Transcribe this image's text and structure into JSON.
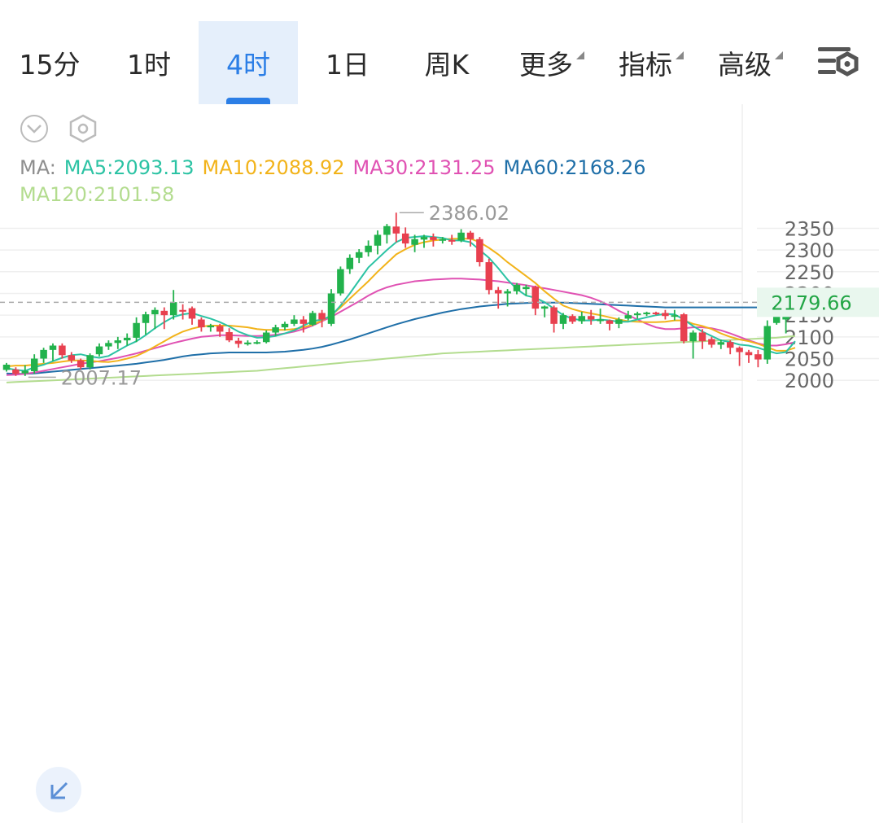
{
  "tabs": [
    {
      "label": "15分",
      "active": false
    },
    {
      "label": "1时",
      "active": false
    },
    {
      "label": "4时",
      "active": true
    },
    {
      "label": "1日",
      "active": false
    },
    {
      "label": "周K",
      "active": false
    },
    {
      "label": "更多",
      "active": false,
      "dropdown": true
    },
    {
      "label": "指标",
      "active": false,
      "dropdown": true
    },
    {
      "label": "高级",
      "active": false,
      "dropdown": true
    }
  ],
  "icons": {
    "settings": "settings-sliders-icon",
    "collapse": "chevron-circle-down-icon",
    "indicator": "hexagon-icon",
    "expand": "expand-arrows-icon"
  },
  "ma_legend": {
    "prefix": "MA:",
    "ma5": "MA5:2093.13",
    "ma10": "MA10:2088.92",
    "ma30": "MA30:2131.25",
    "ma60": "MA60:2168.26",
    "ma120": "MA120:2101.58"
  },
  "colors": {
    "up": "#22b24c",
    "down": "#e8404f",
    "ma5": "#2cc3a4",
    "ma10": "#f2b31a",
    "ma30": "#e052b3",
    "ma60": "#1f6fa8",
    "ma120": "#b3dc8f",
    "active_tab": "#2b7ee6"
  },
  "chart_data": {
    "type": "candlestick",
    "y_ticks": [
      "2350",
      "2300",
      "2250",
      "2200",
      "2150",
      "2100",
      "2050",
      "2000"
    ],
    "ylim": [
      1985,
      2400
    ],
    "grid": true,
    "high_label": "2386.02",
    "low_label": "2007.17",
    "current_price": "2179.66",
    "current_value": 2179.66,
    "candles": [
      [
        2024,
        2036,
        2020,
        2040
      ],
      [
        2025,
        2015,
        2010,
        2030
      ],
      [
        2016,
        2022,
        2010,
        2035
      ],
      [
        2021,
        2050,
        2015,
        2060
      ],
      [
        2050,
        2070,
        2040,
        2075
      ],
      [
        2070,
        2080,
        2045,
        2085
      ],
      [
        2080,
        2058,
        2050,
        2085
      ],
      [
        2058,
        2046,
        2040,
        2065
      ],
      [
        2046,
        2030,
        2025,
        2050
      ],
      [
        2030,
        2058,
        2025,
        2062
      ],
      [
        2060,
        2078,
        2055,
        2085
      ],
      [
        2078,
        2086,
        2070,
        2092
      ],
      [
        2086,
        2092,
        2072,
        2100
      ],
      [
        2092,
        2098,
        2080,
        2108
      ],
      [
        2098,
        2132,
        2088,
        2145
      ],
      [
        2132,
        2152,
        2105,
        2158
      ],
      [
        2152,
        2162,
        2118,
        2168
      ],
      [
        2160,
        2150,
        2118,
        2168
      ],
      [
        2150,
        2180,
        2140,
        2208
      ],
      [
        2162,
        2158,
        2140,
        2175
      ],
      [
        2166,
        2142,
        2128,
        2170
      ],
      [
        2140,
        2122,
        2112,
        2145
      ],
      [
        2122,
        2126,
        2112,
        2130
      ],
      [
        2125,
        2112,
        2100,
        2130
      ],
      [
        2111,
        2092,
        2088,
        2120
      ],
      [
        2091,
        2084,
        2075,
        2098
      ],
      [
        2083,
        2087,
        2080,
        2092
      ],
      [
        2085,
        2088,
        2083,
        2092
      ],
      [
        2088,
        2110,
        2085,
        2115
      ],
      [
        2110,
        2122,
        2102,
        2128
      ],
      [
        2122,
        2130,
        2115,
        2135
      ],
      [
        2130,
        2140,
        2125,
        2150
      ],
      [
        2140,
        2130,
        2110,
        2148
      ],
      [
        2128,
        2155,
        2125,
        2160
      ],
      [
        2155,
        2140,
        2122,
        2162
      ],
      [
        2130,
        2200,
        2125,
        2210
      ],
      [
        2200,
        2256,
        2195,
        2262
      ],
      [
        2256,
        2282,
        2245,
        2290
      ],
      [
        2282,
        2295,
        2270,
        2302
      ],
      [
        2295,
        2310,
        2285,
        2322
      ],
      [
        2310,
        2335,
        2290,
        2345
      ],
      [
        2335,
        2355,
        2315,
        2360
      ],
      [
        2354,
        2338,
        2318,
        2386
      ],
      [
        2338,
        2315,
        2305,
        2352
      ],
      [
        2312,
        2325,
        2295,
        2335
      ],
      [
        2324,
        2330,
        2305,
        2335
      ],
      [
        2330,
        2323,
        2308,
        2338
      ],
      [
        2322,
        2325,
        2315,
        2330
      ],
      [
        2323,
        2322,
        2312,
        2335
      ],
      [
        2322,
        2340,
        2318,
        2348
      ],
      [
        2340,
        2325,
        2308,
        2344
      ],
      [
        2325,
        2272,
        2262,
        2330
      ],
      [
        2272,
        2208,
        2198,
        2280
      ],
      [
        2208,
        2200,
        2165,
        2215
      ],
      [
        2200,
        2205,
        2170,
        2210
      ],
      [
        2205,
        2220,
        2198,
        2224
      ],
      [
        2210,
        2215,
        2195,
        2220
      ],
      [
        2215,
        2165,
        2150,
        2218
      ],
      [
        2165,
        2170,
        2145,
        2172
      ],
      [
        2168,
        2130,
        2110,
        2172
      ],
      [
        2130,
        2150,
        2118,
        2155
      ],
      [
        2148,
        2135,
        2130,
        2152
      ],
      [
        2136,
        2148,
        2130,
        2158
      ],
      [
        2148,
        2140,
        2128,
        2162
      ],
      [
        2140,
        2140,
        2130,
        2165
      ],
      [
        2138,
        2130,
        2115,
        2140
      ],
      [
        2130,
        2140,
        2120,
        2145
      ],
      [
        2142,
        2150,
        2138,
        2160
      ],
      [
        2150,
        2154,
        2142,
        2158
      ],
      [
        2154,
        2156,
        2148,
        2158
      ],
      [
        2156,
        2155,
        2150,
        2158
      ],
      [
        2155,
        2148,
        2140,
        2162
      ],
      [
        2148,
        2150,
        2138,
        2162
      ],
      [
        2152,
        2090,
        2085,
        2155
      ],
      [
        2090,
        2110,
        2050,
        2115
      ],
      [
        2110,
        2090,
        2072,
        2118
      ],
      [
        2095,
        2082,
        2075,
        2100
      ],
      [
        2082,
        2088,
        2072,
        2094
      ],
      [
        2088,
        2075,
        2060,
        2092
      ],
      [
        2075,
        2065,
        2033,
        2078
      ],
      [
        2065,
        2058,
        2040,
        2070
      ],
      [
        2060,
        2048,
        2030,
        2070
      ],
      [
        2048,
        2125,
        2038,
        2138
      ],
      [
        2132,
        2148,
        2128,
        2190
      ],
      [
        2140,
        2180,
        2108,
        2188
      ]
    ],
    "ma5": [
      2028,
      2024,
      2022,
      2030,
      2036,
      2044,
      2052,
      2058,
      2060,
      2055,
      2052,
      2056,
      2068,
      2080,
      2090,
      2104,
      2120,
      2134,
      2146,
      2152,
      2155,
      2148,
      2142,
      2134,
      2124,
      2112,
      2104,
      2098,
      2099,
      2102,
      2108,
      2115,
      2126,
      2136,
      2140,
      2148,
      2172,
      2200,
      2230,
      2260,
      2280,
      2300,
      2318,
      2328,
      2330,
      2332,
      2330,
      2328,
      2322,
      2322,
      2318,
      2300,
      2282,
      2258,
      2232,
      2210,
      2195,
      2190,
      2180,
      2165,
      2150,
      2142,
      2138,
      2138,
      2140,
      2138,
      2135,
      2135,
      2140,
      2145,
      2150,
      2153,
      2152,
      2140,
      2125,
      2112,
      2102,
      2092,
      2088,
      2082,
      2080,
      2075,
      2068,
      2062,
      2065,
      2090
    ],
    "ma10": [
      2032,
      2034,
      2034,
      2036,
      2038,
      2040,
      2043,
      2046,
      2046,
      2045,
      2043,
      2042,
      2045,
      2050,
      2056,
      2066,
      2078,
      2090,
      2102,
      2112,
      2119,
      2124,
      2126,
      2126,
      2126,
      2124,
      2122,
      2118,
      2116,
      2116,
      2116,
      2118,
      2122,
      2128,
      2138,
      2150,
      2168,
      2188,
      2208,
      2228,
      2250,
      2270,
      2290,
      2302,
      2312,
      2318,
      2322,
      2324,
      2326,
      2326,
      2326,
      2318,
      2305,
      2290,
      2272,
      2256,
      2240,
      2224,
      2205,
      2188,
      2172,
      2164,
      2158,
      2154,
      2150,
      2145,
      2140,
      2136,
      2135,
      2134,
      2134,
      2135,
      2138,
      2138,
      2130,
      2125,
      2118,
      2108,
      2100,
      2094,
      2090,
      2084,
      2076,
      2068,
      2068,
      2075
    ],
    "ma30": [
      2012,
      2013,
      2015,
      2018,
      2022,
      2026,
      2030,
      2034,
      2038,
      2041,
      2044,
      2048,
      2052,
      2057,
      2062,
      2068,
      2074,
      2080,
      2086,
      2091,
      2096,
      2100,
      2102,
      2104,
      2104,
      2103,
      2102,
      2102,
      2103,
      2105,
      2108,
      2112,
      2118,
      2126,
      2136,
      2146,
      2158,
      2170,
      2182,
      2195,
      2206,
      2214,
      2220,
      2224,
      2228,
      2230,
      2232,
      2233,
      2234,
      2234,
      2233,
      2232,
      2230,
      2228,
      2225,
      2222,
      2219,
      2215,
      2212,
      2208,
      2204,
      2200,
      2196,
      2190,
      2182,
      2172,
      2160,
      2150,
      2140,
      2130,
      2122,
      2118,
      2118,
      2120,
      2122,
      2122,
      2120,
      2115,
      2108,
      2100,
      2092,
      2085,
      2080,
      2080,
      2083,
      2088
    ],
    "ma60": [
      2016,
      2015,
      2015,
      2016,
      2018,
      2020,
      2022,
      2024,
      2026,
      2028,
      2030,
      2032,
      2034,
      2036,
      2038,
      2041,
      2044,
      2047,
      2051,
      2055,
      2058,
      2060,
      2062,
      2063,
      2064,
      2064,
      2064,
      2064,
      2064,
      2065,
      2066,
      2068,
      2070,
      2073,
      2077,
      2082,
      2088,
      2094,
      2101,
      2108,
      2115,
      2122,
      2129,
      2135,
      2141,
      2146,
      2151,
      2156,
      2160,
      2164,
      2167,
      2170,
      2172,
      2174,
      2176,
      2177,
      2178,
      2179,
      2179,
      2179,
      2179,
      2178,
      2177,
      2176,
      2175,
      2174,
      2173,
      2172,
      2171,
      2170,
      2169,
      2168,
      2168,
      2168,
      2168,
      2168,
      2168,
      2168,
      2168,
      2168,
      2168,
      2168,
      2168,
      2168,
      2168,
      2169
    ],
    "ma120": [
      1995,
      1996,
      1997,
      1998,
      1999,
      2000,
      2001,
      2002,
      2003,
      2004,
      2005,
      2006,
      2007,
      2008,
      2009,
      2010,
      2011,
      2012,
      2013,
      2014,
      2015,
      2016,
      2017,
      2018,
      2019,
      2020,
      2021,
      2022,
      2024,
      2026,
      2028,
      2030,
      2032,
      2034,
      2036,
      2038,
      2040,
      2042,
      2044,
      2046,
      2048,
      2050,
      2052,
      2054,
      2056,
      2058,
      2060,
      2062,
      2063,
      2064,
      2065,
      2066,
      2067,
      2068,
      2069,
      2070,
      2071,
      2072,
      2073,
      2074,
      2075,
      2076,
      2077,
      2078,
      2079,
      2080,
      2081,
      2082,
      2083,
      2084,
      2085,
      2086,
      2087,
      2088,
      2089,
      2090,
      2091,
      2092,
      2093,
      2094,
      2095,
      2096,
      2097,
      2098,
      2100,
      2102
    ]
  }
}
